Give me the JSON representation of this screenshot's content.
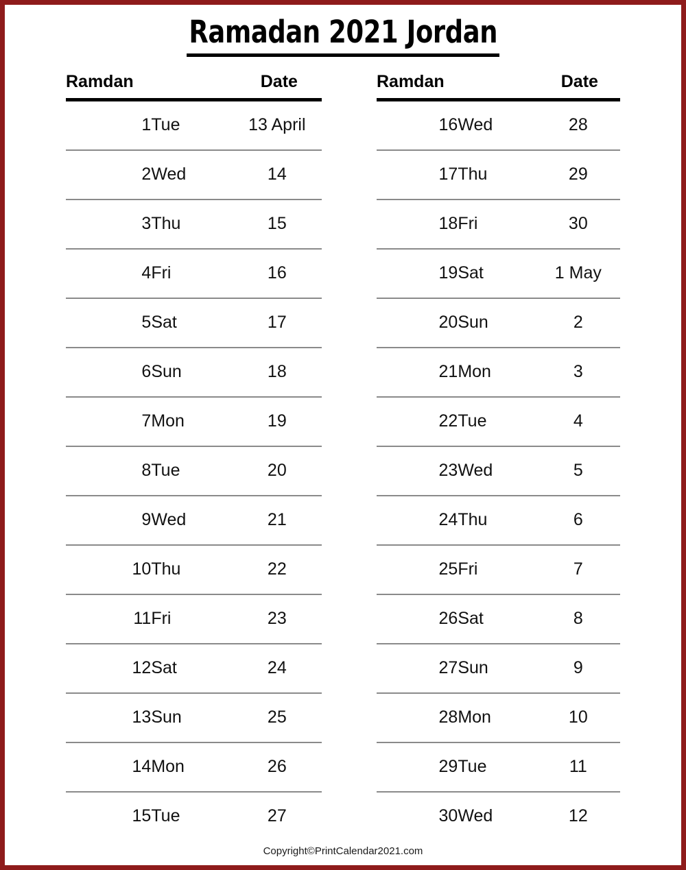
{
  "document": {
    "title": "Ramadan 2021 Jordan",
    "border_color": "#8e1b1b",
    "accent_color": "#ee1c1c"
  },
  "footer": {
    "copyright": "Copyright©PrintCalendar2021.com"
  },
  "table": {
    "headers": {
      "ramdan": "Ramdan",
      "date": "Date"
    },
    "left_rows": [
      {
        "num": "1",
        "day": "Tue",
        "date": "13 April"
      },
      {
        "num": "2",
        "day": "Wed",
        "date": "14"
      },
      {
        "num": "3",
        "day": "Thu",
        "date": "15"
      },
      {
        "num": "4",
        "day": "Fri",
        "date": "16"
      },
      {
        "num": "5",
        "day": "Sat",
        "date": "17"
      },
      {
        "num": "6",
        "day": "Sun",
        "date": "18"
      },
      {
        "num": "7",
        "day": "Mon",
        "date": "19"
      },
      {
        "num": "8",
        "day": "Tue",
        "date": "20"
      },
      {
        "num": "9",
        "day": "Wed",
        "date": "21"
      },
      {
        "num": "10",
        "day": "Thu",
        "date": "22"
      },
      {
        "num": "11",
        "day": "Fri",
        "date": "23"
      },
      {
        "num": "12",
        "day": "Sat",
        "date": "24"
      },
      {
        "num": "13",
        "day": "Sun",
        "date": "25"
      },
      {
        "num": "14",
        "day": "Mon",
        "date": "26"
      },
      {
        "num": "15",
        "day": "Tue",
        "date": "27"
      }
    ],
    "right_rows": [
      {
        "num": "16",
        "day": "Wed",
        "date": "28"
      },
      {
        "num": "17",
        "day": "Thu",
        "date": "29"
      },
      {
        "num": "18",
        "day": "Fri",
        "date": "30"
      },
      {
        "num": "19",
        "day": "Sat",
        "date": "1 May"
      },
      {
        "num": "20",
        "day": "Sun",
        "date": "2"
      },
      {
        "num": "21",
        "day": "Mon",
        "date": "3"
      },
      {
        "num": "22",
        "day": "Tue",
        "date": "4"
      },
      {
        "num": "23",
        "day": "Wed",
        "date": "5"
      },
      {
        "num": "24",
        "day": "Thu",
        "date": "6"
      },
      {
        "num": "25",
        "day": "Fri",
        "date": "7"
      },
      {
        "num": "26",
        "day": "Sat",
        "date": "8"
      },
      {
        "num": "27",
        "day": "Sun",
        "date": "9"
      },
      {
        "num": "28",
        "day": "Mon",
        "date": "10"
      },
      {
        "num": "29",
        "day": "Tue",
        "date": "11"
      },
      {
        "num": "30",
        "day": "Wed",
        "date": "12"
      }
    ]
  }
}
